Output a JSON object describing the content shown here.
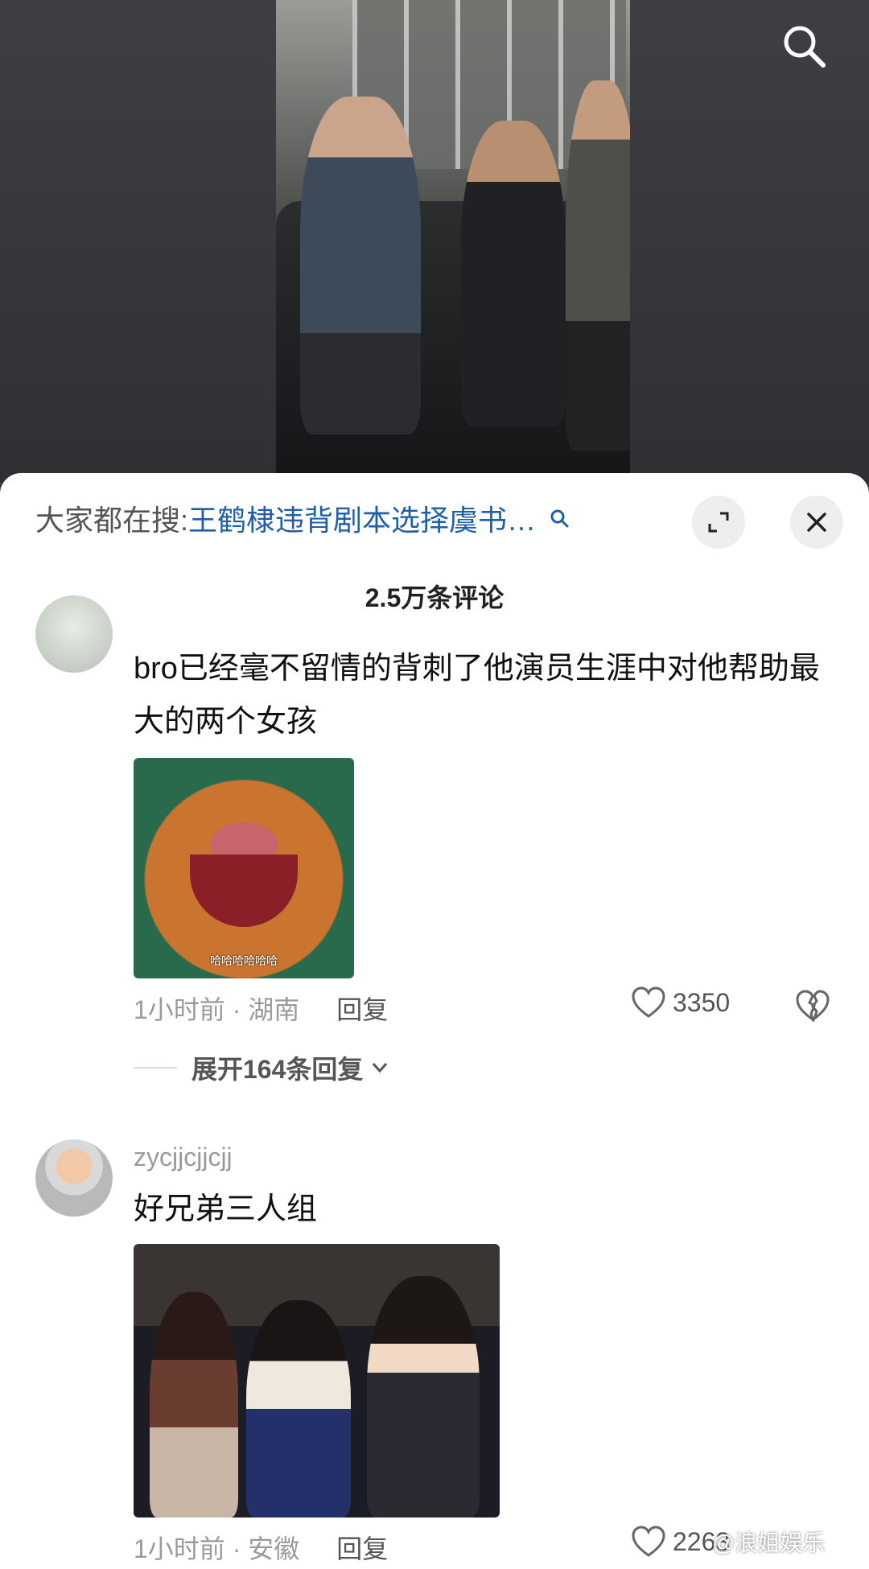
{
  "header": {
    "search_icon": "search-icon"
  },
  "trend": {
    "prefix": "大家都在搜:",
    "query": "王鹤棣违背剧本选择虞书…"
  },
  "comments_header": {
    "count": "2.5万条评论"
  },
  "comments": [
    {
      "text": "bro已经毫不留情的背刺了他演员生涯中对他帮助最大的两个女孩",
      "image_caption": "哈哈哈哈哈哈",
      "time_location": "1小时前 · 湖南",
      "reply_label": "回复",
      "likes": "3350",
      "expand_replies": "展开164条回复"
    },
    {
      "username": "zycjjcjjcjj",
      "text": "好兄弟三人组",
      "time_location": "1小时前 · 安徽",
      "reply_label": "回复",
      "likes": "2263"
    }
  ],
  "watermark": "@浪姐娱乐",
  "colors": {
    "accent_link": "#1f5fa8",
    "sheet_bg": "#ffffff"
  }
}
